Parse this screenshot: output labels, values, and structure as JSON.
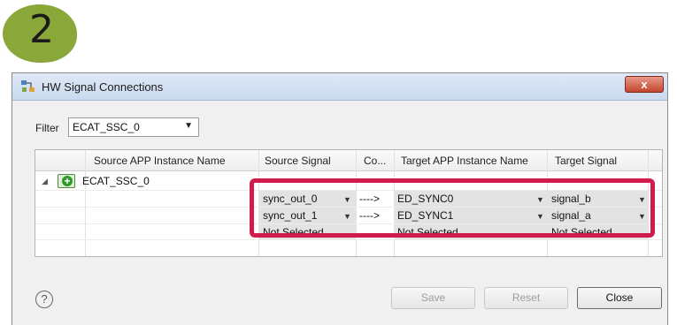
{
  "step": {
    "number": "2"
  },
  "window": {
    "title": "HW Signal Connections",
    "close_glyph": "x"
  },
  "filter": {
    "label": "Filter",
    "value": "ECAT_SSC_0"
  },
  "table": {
    "columns": [
      "Source APP Instance Name",
      "Source Signal",
      "Co...",
      "Target APP Instance Name",
      "Target Signal"
    ],
    "instance": "ECAT_SSC_0",
    "rows": [
      {
        "source_signal": "sync_out_0",
        "connector": "---->",
        "target_instance": "ED_SYNC0",
        "target_signal": "signal_b"
      },
      {
        "source_signal": "sync_out_1",
        "connector": "---->",
        "target_instance": "ED_SYNC1",
        "target_signal": "signal_a"
      },
      {
        "source_signal": "Not Selected",
        "connector": "",
        "target_instance": "Not Selected",
        "target_signal": "Not Selected"
      }
    ]
  },
  "buttons": {
    "save": "Save",
    "reset": "Reset",
    "close": "Close"
  },
  "help": {
    "glyph": "?"
  },
  "colors": {
    "highlight": "#d01b4c",
    "badge": "#8aa83a"
  }
}
